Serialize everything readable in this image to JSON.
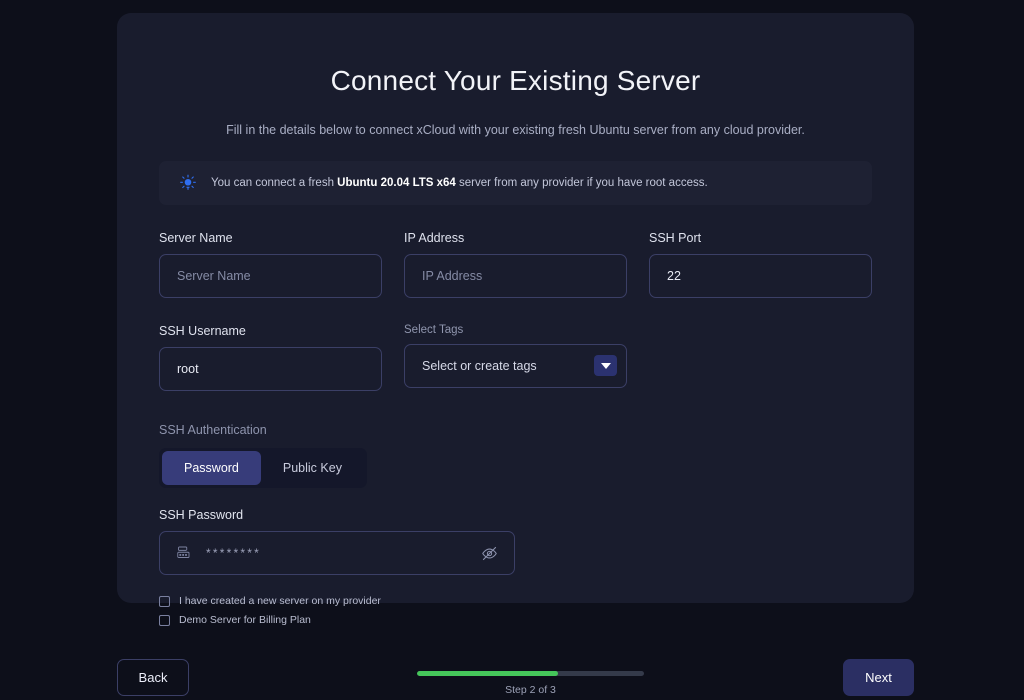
{
  "header": {
    "title": "Connect Your Existing Server",
    "subtitle": "Fill in the details below to connect xCloud with your existing fresh Ubuntu server from any cloud provider."
  },
  "info_banner": {
    "icon": "lightbulb-icon",
    "text_before": "You can connect a fresh ",
    "text_bold": "Ubuntu 20.04 LTS x64",
    "text_after": " server from any provider if you have root access."
  },
  "form": {
    "server_name": {
      "label": "Server Name",
      "placeholder": "Server Name",
      "value": ""
    },
    "ip_address": {
      "label": "IP Address",
      "placeholder": "IP Address",
      "value": ""
    },
    "ssh_port": {
      "label": "SSH Port",
      "placeholder": "SSH Port",
      "value": "22"
    },
    "ssh_username": {
      "label": "SSH Username",
      "placeholder": "SSH Username",
      "value": "root"
    },
    "select_tags": {
      "label": "Select Tags",
      "placeholder": "Select or create tags",
      "caret_icon": "chevron-down-icon"
    }
  },
  "auth": {
    "label": "SSH Authentication",
    "options": [
      "Password",
      "Public Key"
    ],
    "selected": "Password"
  },
  "password": {
    "label": "SSH Password",
    "value": "••••••••",
    "masked_display": "********",
    "left_icon": "autofill-icon",
    "toggle_icon": "eye-off-icon"
  },
  "checkboxes": [
    {
      "label": "I have created a new server on my provider",
      "checked": false
    },
    {
      "label": "Demo Server for Billing Plan",
      "checked": false
    }
  ],
  "footer": {
    "back_label": "Back",
    "next_label": "Next",
    "step_text": "Step 2 of 3",
    "progress_percent": 62
  },
  "colors": {
    "page_background": "#0d0f1a",
    "card_background": "#191c2d",
    "banner_background": "#1e2133",
    "input_border": "#3b3f66",
    "accent_indigo": "#373c7a",
    "next_button": "#2b2f63",
    "progress_green": "#45c65a",
    "bulb_blue": "#2f6ef0"
  }
}
